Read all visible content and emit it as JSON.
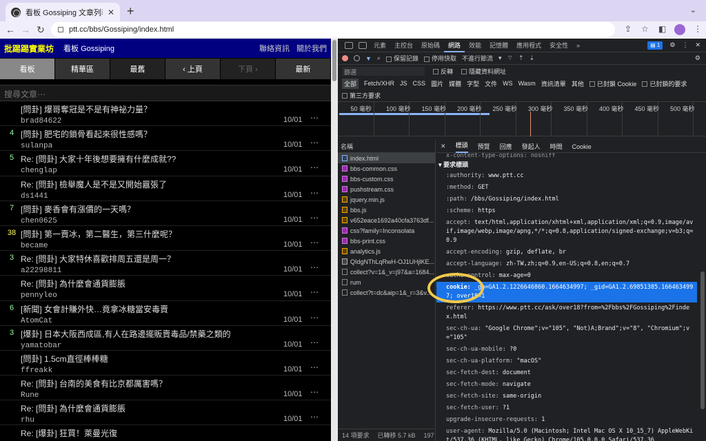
{
  "browser": {
    "tab_title": "看板 Gossiping 文章列表 - 批踢踢",
    "url": "ptt.cc/bbs/Gossiping/index.html"
  },
  "ptt": {
    "brand": "批踢踢實業坊",
    "board": "看板 Gossiping",
    "links": [
      "聯絡資訊",
      "關於我們"
    ],
    "buttons": [
      "看板",
      "精華區",
      "最舊",
      "‹ 上頁",
      "下頁 ›",
      "最新"
    ],
    "search_placeholder": "搜尋文章⋯",
    "posts": [
      {
        "count": "",
        "title": "[問卦] 爆哥奪冠是不是有神祕力量？",
        "author": "brad84622",
        "date": "10/01"
      },
      {
        "count": "4",
        "title": "[問卦] 肥宅的鎖骨看起來很性感嗎？",
        "author": "sulanpa",
        "date": "10/01"
      },
      {
        "count": "5",
        "title": "Re: [問卦] 大家十年後想要擁有什麼成就??",
        "author": "chenglap",
        "date": "10/01"
      },
      {
        "count": "",
        "title": "Re: [問卦] 檢舉魔人是不是又開始囂張了",
        "author": "ds1441",
        "date": "10/01"
      },
      {
        "count": "7",
        "title": "[問卦] 麥香會有漲價的一天嗎？",
        "author": "chen0625",
        "date": "10/01"
      },
      {
        "count": "38",
        "title": "[問卦] 第一賣冰，第二醫生，第三什麼呢？",
        "author": "became",
        "date": "10/01"
      },
      {
        "count": "3",
        "title": "Re: [問卦] 大家特休喜歡排周五還是周一？",
        "author": "a22298811",
        "date": "10/01"
      },
      {
        "count": "",
        "title": "Re: [問卦] 為什麼會通貨膨脹",
        "author": "pennyleo",
        "date": "10/01"
      },
      {
        "count": "6",
        "title": "[新聞] 女會計賺外快…竟拿冰糖當安毒賣",
        "author": "AtomCat",
        "date": "10/01"
      },
      {
        "count": "3",
        "title": "[爆卦] 日本大阪西成區,有人在路邊擺販賣毒品/禁藥之類的",
        "author": "yamatobar",
        "date": "10/01"
      },
      {
        "count": "",
        "title": "[問卦] 1.5cm直徑棒棒糖",
        "author": "ffreakk",
        "date": "10/01"
      },
      {
        "count": "",
        "title": "Re: [問卦] 台南的美食有比京都厲害嗎？",
        "author": "Rune",
        "date": "10/01"
      },
      {
        "count": "",
        "title": "Re: [問卦] 為什麼會通貨膨脹",
        "author": "rhu",
        "date": "10/01"
      },
      {
        "count": "",
        "title": "Re: [爆卦] 狂買！萊曼光復",
        "author": "",
        "date": ""
      }
    ]
  },
  "devtools": {
    "tabs": [
      "元素",
      "主控台",
      "原始碼",
      "網路",
      "效能",
      "記憶體",
      "應用程式",
      "安全性"
    ],
    "tabs_more": "»",
    "issues": "1",
    "toolbar": {
      "preserve_log": "保留記錄",
      "disable_cache": "停用快取",
      "throttle": "不進行節流"
    },
    "filter": {
      "placeholder": "篩選",
      "invert": "反轉",
      "hide_data": "隱藏資料網址"
    },
    "types": [
      "全部",
      "Fetch/XHR",
      "JS",
      "CSS",
      "圖片",
      "媒體",
      "字型",
      "文件",
      "WS",
      "Wasm",
      "資訊清單",
      "其他"
    ],
    "blocked_cookies": "已封鎖 Cookie",
    "blocked_requests": "已封鎖的要求",
    "third_party": "第三方要求",
    "timeline": [
      "50 毫秒",
      "100 毫秒",
      "150 毫秒",
      "200 毫秒",
      "250 毫秒",
      "300 毫秒",
      "350 毫秒",
      "400 毫秒",
      "450 毫秒",
      "500 毫秒"
    ],
    "name_header": "名稱",
    "requests": [
      {
        "name": "index.html",
        "type": "doc"
      },
      {
        "name": "bbs-common.css",
        "type": "css"
      },
      {
        "name": "bbs-custom.css",
        "type": "css"
      },
      {
        "name": "pushstream.css",
        "type": "css"
      },
      {
        "name": "jquery.min.js",
        "type": "js"
      },
      {
        "name": "bbs.js",
        "type": "js"
      },
      {
        "name": "v652eace1692a40cfa3763df...",
        "type": "js"
      },
      {
        "name": "css?family=Inconsolata",
        "type": "css"
      },
      {
        "name": "bbs-print.css",
        "type": "css"
      },
      {
        "name": "analytics.js",
        "type": "js"
      },
      {
        "name": "QIdgNThLqRwH-OJ1UHjlKE...",
        "type": "font"
      },
      {
        "name": "collect?v=1&_v=j97&a=1684...",
        "type": "oth"
      },
      {
        "name": "rum",
        "type": "oth"
      },
      {
        "name": "collect?t=dc&aip=1&_r=3&v...",
        "type": "oth"
      }
    ],
    "footer": {
      "requests": "14 項要求",
      "transferred": "已轉移 5.7 kB",
      "more": "197"
    },
    "detail_tabs": [
      "標頭",
      "預覽",
      "回應",
      "發起人",
      "時間",
      "Cookie"
    ],
    "top_header": "x-content-type-options: nosniff",
    "section": "▾ 要求標頭",
    "headers": [
      {
        "k": ":authority:",
        "v": "www.ptt.cc"
      },
      {
        "k": ":method:",
        "v": "GET"
      },
      {
        "k": ":path:",
        "v": "/bbs/Gossiping/index.html"
      },
      {
        "k": ":scheme:",
        "v": "https"
      },
      {
        "k": "accept:",
        "v": "text/html,application/xhtml+xml,application/xml;q=0.9,image/avif,image/webp,image/apng,*/*;q=0.8,application/signed-exchange;v=b3;q=0.9"
      },
      {
        "k": "accept-encoding:",
        "v": "gzip, deflate, br"
      },
      {
        "k": "accept-language:",
        "v": "zh-TW,zh;q=0.9,en-US;q=0.8,en;q=0.7"
      },
      {
        "k": "cache-control:",
        "v": "max-age=0"
      },
      {
        "k": "cookie:",
        "v": "_ga=GA1.2.1226646860.1664634997; _gid=GA1.2.69851385.1664634997; over18=1",
        "hl": true
      },
      {
        "k": "referer:",
        "v": "https://www.ptt.cc/ask/over18?from=%2Fbbs%2FGossiping%2Findex.html"
      },
      {
        "k": "sec-ch-ua:",
        "v": "\"Google Chrome\";v=\"105\", \"Not)A;Brand\";v=\"8\", \"Chromium\";v=\"105\""
      },
      {
        "k": "sec-ch-ua-mobile:",
        "v": "?0"
      },
      {
        "k": "sec-ch-ua-platform:",
        "v": "\"macOS\""
      },
      {
        "k": "sec-fetch-dest:",
        "v": "document"
      },
      {
        "k": "sec-fetch-mode:",
        "v": "navigate"
      },
      {
        "k": "sec-fetch-site:",
        "v": "same-origin"
      },
      {
        "k": "sec-fetch-user:",
        "v": "?1"
      },
      {
        "k": "upgrade-insecure-requests:",
        "v": "1"
      },
      {
        "k": "user-agent:",
        "v": "Mozilla/5.0 (Macintosh; Intel Mac OS X 10_15_7) AppleWebKit/537.36 (KHTML, like Gecko) Chrome/105.0.0.0 Safari/537.36"
      }
    ]
  }
}
